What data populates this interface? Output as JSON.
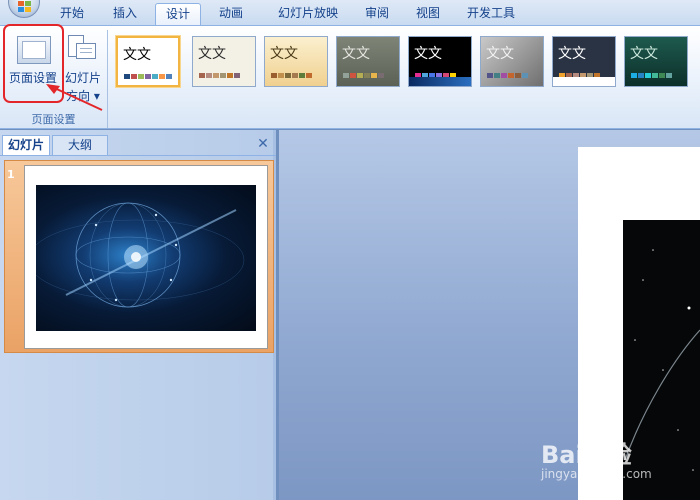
{
  "tabs": [
    "开始",
    "插入",
    "设计",
    "动画",
    "幻灯片放映",
    "审阅",
    "视图",
    "开发工具"
  ],
  "active_tab": "设计",
  "ribbon": {
    "page_setup_button": "页面设置",
    "orientation_button_line1": "幻灯片",
    "orientation_button_line2": "方向",
    "dropdown_arrow": "▾",
    "group_label": "页面设置"
  },
  "themes": [
    {
      "label": "文文",
      "bg": "#ffffff",
      "fg": "#000000"
    },
    {
      "label": "文文",
      "bg": "#f3f0e6",
      "fg": "#2b2b2b"
    },
    {
      "label": "文文",
      "bg": "#f6e3b4",
      "fg": "#4a3a18"
    },
    {
      "label": "文文",
      "bg": "#6d7466",
      "fg": "#e7e7e2"
    },
    {
      "label": "文文",
      "bg": "#000000",
      "fg": "#ffffff"
    },
    {
      "label": "文文",
      "bg": "#8c8c8c",
      "fg": "#f2f2f2"
    },
    {
      "label": "文文",
      "bg": "#2a3344",
      "fg": "#ffffff"
    },
    {
      "label": "文文",
      "bg": "#123f37",
      "fg": "#cde8dc"
    }
  ],
  "left_pane": {
    "tab_slides": "幻灯片",
    "tab_outline": "大纲",
    "close_symbol": "✕",
    "slide_number": "1"
  },
  "watermark": {
    "brand": "Bai经验",
    "url": "jingyan.baidu.com"
  },
  "colors": {
    "ribbon_text": "#15428b",
    "highlight": "#e3262a",
    "selected_slide": "#f0b47a",
    "selected_theme": "#f2b541"
  }
}
